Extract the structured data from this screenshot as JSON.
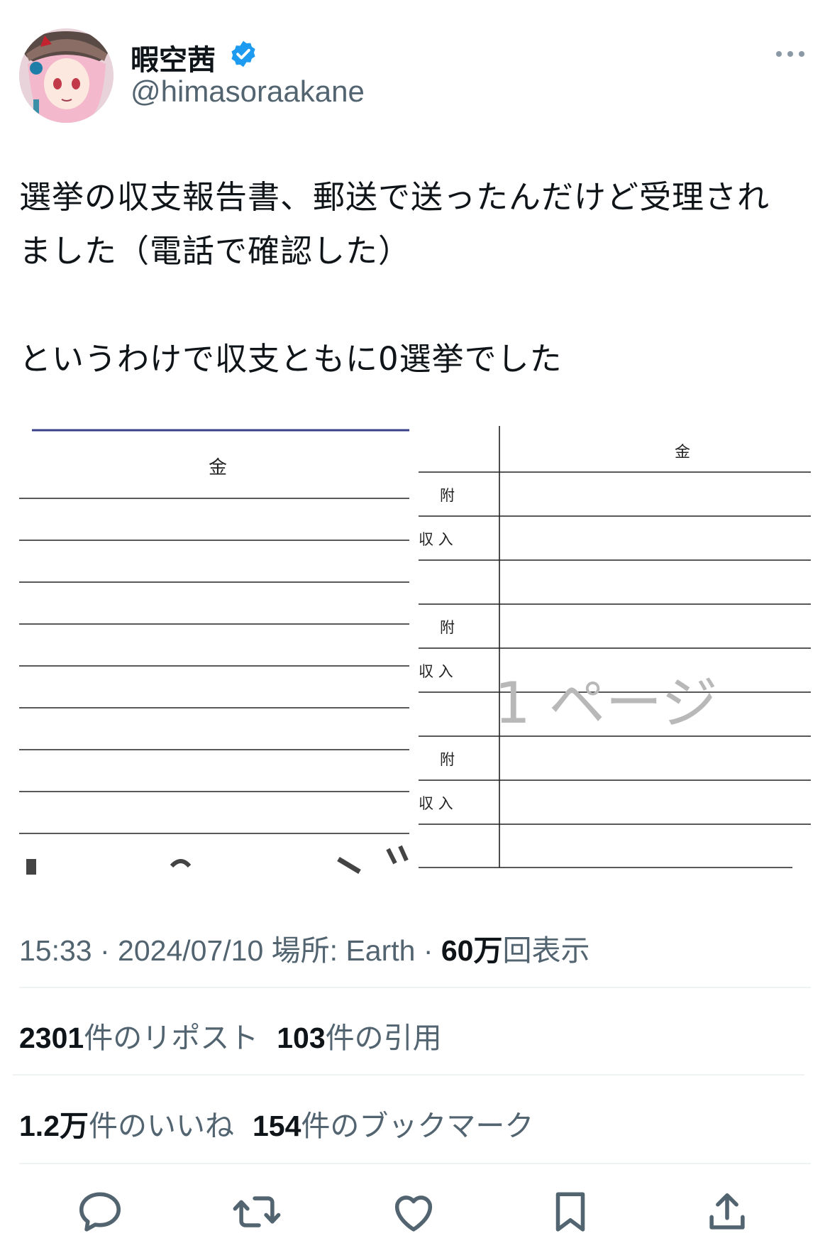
{
  "author": {
    "display_name": "暇空茜",
    "handle": "@himasoraakane",
    "avatar_icon": "avatar-anime-girl",
    "verified_icon": "verified-badge-icon",
    "verified_color": "#1d9bf0"
  },
  "more_icon": "more-dots-icon",
  "tweet": {
    "lines": [
      "選挙の収支報告書、郵送で送ったんだけど受理され",
      "ました（電話で確認した）",
      "",
      "というわけで収支ともに0選挙でした"
    ]
  },
  "attached_image": {
    "left_panel": {
      "header": "金"
    },
    "right_panel": {
      "header": "金",
      "row_labels": [
        "附",
        "収 入",
        "",
        "附",
        "収 入",
        "",
        "附",
        "収 入",
        ""
      ],
      "watermark": "1 ページ"
    }
  },
  "meta": {
    "time": "15:33",
    "separator": " · ",
    "date": "2024/07/10",
    "location_label": "場所: Earth",
    "views_count": "60万",
    "views_label": "回表示"
  },
  "stats": {
    "reposts_count": "2301",
    "reposts_label": "件のリポスト",
    "quotes_count": "103",
    "quotes_label": "件の引用",
    "likes_count": "1.2万",
    "likes_label": "件のいいね",
    "bookmarks_count": "154",
    "bookmarks_label": "件のブックマーク"
  },
  "actions": {
    "icons": [
      "reply-icon",
      "repost-icon",
      "like-icon",
      "bookmark-icon",
      "share-icon"
    ],
    "icon_color": "#536471"
  }
}
